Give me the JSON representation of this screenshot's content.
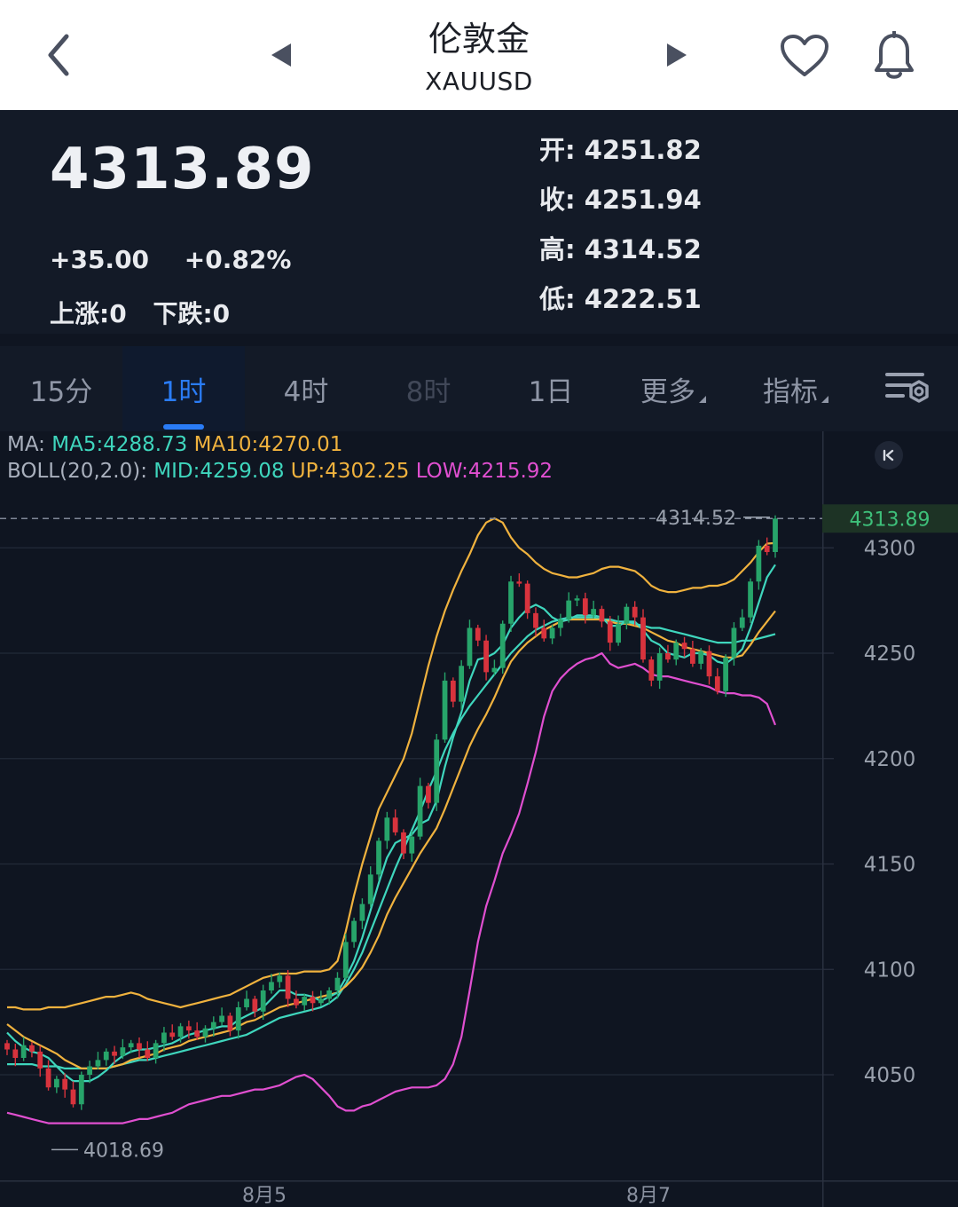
{
  "header": {
    "title": "伦敦金",
    "symbol": "XAUUSD"
  },
  "quote": {
    "price": "4313.89",
    "change": "+35.00",
    "change_pct": "+0.82%",
    "rise_label": "上涨:0",
    "fall_label": "下跌:0",
    "open": "开: 4251.82",
    "close": "收: 4251.94",
    "high": "高: 4314.52",
    "low": "低: 4222.51"
  },
  "tabs": {
    "m15": "15分",
    "h1": "1时",
    "h4": "4时",
    "h8": "8时",
    "d1": "1日",
    "more": "更多",
    "indicators": "指标"
  },
  "legend": {
    "ma_prefix": "MA: ",
    "ma5": "MA5:4288.73",
    "ma10": "MA10:4270.01",
    "boll_prefix": "BOLL(20,2.0): ",
    "boll_mid": "MID:4259.08",
    "boll_up": "UP:4302.25",
    "boll_low": "LOW:4215.92"
  },
  "colors": {
    "up": "#27a46a",
    "down": "#d8333d",
    "ma5": "#3fd6bd",
    "ma10": "#f0b23e",
    "boll_up": "#f0b23e",
    "boll_mid": "#3fd6bd",
    "boll_low": "#e04fd0",
    "accent": "#2a7cf6"
  },
  "chart_data": {
    "type": "candlestick",
    "timeframe": "1时",
    "ylim": [
      4010,
      4330
    ],
    "y_ticks": [
      "4300",
      "4250",
      "4200",
      "4150",
      "4100",
      "4050"
    ],
    "x_labels": [
      "8月5",
      "8月7"
    ],
    "current_price": "4313.89",
    "max_marker": "4314.52",
    "min_marker": "4018.69",
    "legend_items": [
      "MA5",
      "MA10",
      "MID",
      "UP",
      "LOW"
    ],
    "close": [
      4062,
      4058,
      4064,
      4061,
      4053,
      4044,
      4048,
      4043,
      4036,
      4050,
      4054,
      4057,
      4061,
      4059,
      4063,
      4065,
      4062,
      4058,
      4065,
      4070,
      4068,
      4073,
      4071,
      4068,
      4072,
      4075,
      4078,
      4071,
      4082,
      4086,
      4080,
      4090,
      4094,
      4097,
      4086,
      4083,
      4087,
      4084,
      4086,
      4090,
      4096,
      4113,
      4123,
      4131,
      4145,
      4161,
      4172,
      4165,
      4155,
      4163,
      4187,
      4179,
      4209,
      4237,
      4227,
      4244,
      4262,
      4256,
      4241,
      4243,
      4264,
      4284,
      4283,
      4269,
      4262,
      4257,
      4262,
      4266,
      4275,
      4276,
      4268,
      4271,
      4265,
      4255,
      4264,
      4272,
      4267,
      4247,
      4237,
      4250,
      4247,
      4255,
      4252,
      4245,
      4251,
      4239,
      4232,
      4248,
      4262,
      4267,
      4284,
      4301,
      4298,
      4313.89
    ],
    "ma5": [
      4070,
      4066,
      4063,
      4061,
      4060,
      4058,
      4054,
      4050,
      4047,
      4047,
      4047,
      4049,
      4052,
      4056,
      4059,
      4061,
      4062,
      4062,
      4063,
      4064,
      4065,
      4067,
      4069,
      4070,
      4071,
      4072,
      4073,
      4073,
      4076,
      4078,
      4080,
      4082,
      4086,
      4090,
      4090,
      4088,
      4088,
      4087,
      4085,
      4087,
      4089,
      4096,
      4104,
      4115,
      4128,
      4141,
      4153,
      4160,
      4162,
      4164,
      4169,
      4171,
      4180,
      4196,
      4210,
      4222,
      4237,
      4247,
      4248,
      4250,
      4254,
      4262,
      4267,
      4271,
      4273,
      4271,
      4267,
      4265,
      4266,
      4268,
      4268,
      4268,
      4267,
      4263,
      4263,
      4265,
      4265,
      4261,
      4256,
      4254,
      4250,
      4249,
      4248,
      4250,
      4250,
      4249,
      4246,
      4245,
      4248,
      4252,
      4262,
      4274,
      4286,
      4292
    ],
    "ma10": [
      4074,
      4071,
      4068,
      4066,
      4064,
      4062,
      4060,
      4057,
      4055,
      4053,
      4053,
      4053,
      4053,
      4054,
      4055,
      4057,
      4058,
      4059,
      4060,
      4062,
      4063,
      4064,
      4066,
      4067,
      4068,
      4069,
      4070,
      4071,
      4073,
      4075,
      4076,
      4078,
      4080,
      4082,
      4083,
      4084,
      4085,
      4086,
      4087,
      4088,
      4089,
      4092,
      4096,
      4101,
      4108,
      4116,
      4126,
      4134,
      4141,
      4148,
      4155,
      4161,
      4167,
      4176,
      4186,
      4196,
      4206,
      4214,
      4221,
      4229,
      4238,
      4246,
      4251,
      4255,
      4258,
      4261,
      4263,
      4265,
      4266,
      4266,
      4266,
      4266,
      4266,
      4265,
      4264,
      4264,
      4263,
      4262,
      4260,
      4258,
      4256,
      4255,
      4253,
      4252,
      4251,
      4250,
      4249,
      4248,
      4248,
      4249,
      4254,
      4260,
      4265,
      4270
    ],
    "boll_up": [
      4082,
      4082,
      4081,
      4081,
      4081,
      4082,
      4082,
      4082,
      4083,
      4084,
      4085,
      4086,
      4087,
      4087,
      4088,
      4089,
      4088,
      4086,
      4085,
      4084,
      4083,
      4082,
      4083,
      4084,
      4085,
      4086,
      4087,
      4088,
      4090,
      4092,
      4094,
      4096,
      4097,
      4098,
      4098,
      4098,
      4099,
      4099,
      4099,
      4100,
      4104,
      4118,
      4135,
      4150,
      4163,
      4176,
      4184,
      4192,
      4200,
      4212,
      4228,
      4244,
      4258,
      4270,
      4280,
      4289,
      4297,
      4306,
      4312,
      4314,
      4312,
      4305,
      4300,
      4297,
      4293,
      4290,
      4288,
      4287,
      4286,
      4286,
      4287,
      4288,
      4290,
      4291,
      4291,
      4290,
      4289,
      4286,
      4282,
      4280,
      4279,
      4279,
      4280,
      4281,
      4281,
      4282,
      4282,
      4283,
      4285,
      4289,
      4293,
      4298,
      4302,
      4302.25
    ],
    "boll_mid": [
      4055,
      4055,
      4055,
      4055,
      4054,
      4054,
      4054,
      4053,
      4053,
      4053,
      4053,
      4053,
      4053,
      4054,
      4055,
      4056,
      4057,
      4057,
      4058,
      4059,
      4060,
      4061,
      4062,
      4063,
      4064,
      4065,
      4066,
      4067,
      4068,
      4069,
      4071,
      4073,
      4075,
      4077,
      4078,
      4079,
      4080,
      4081,
      4082,
      4084,
      4087,
      4093,
      4100,
      4108,
      4118,
      4128,
      4138,
      4148,
      4157,
      4166,
      4175,
      4185,
      4194,
      4204,
      4212,
      4219,
      4225,
      4230,
      4235,
      4240,
      4245,
      4250,
      4254,
      4258,
      4261,
      4263,
      4265,
      4266,
      4267,
      4267,
      4267,
      4267,
      4266,
      4266,
      4265,
      4265,
      4264,
      4263,
      4262,
      4262,
      4261,
      4260,
      4259,
      4258,
      4257,
      4256,
      4255,
      4255,
      4255,
      4256,
      4256,
      4257,
      4258,
      4259.08
    ],
    "boll_low": [
      4032,
      4031,
      4030,
      4029,
      4028,
      4027,
      4027,
      4027,
      4027,
      4027,
      4027,
      4027,
      4027,
      4027,
      4027,
      4028,
      4029,
      4029,
      4030,
      4031,
      4032,
      4034,
      4036,
      4037,
      4038,
      4039,
      4040,
      4040,
      4041,
      4042,
      4043,
      4043,
      4044,
      4045,
      4047,
      4049,
      4050,
      4048,
      4044,
      4040,
      4035,
      4033,
      4033,
      4035,
      4036,
      4038,
      4040,
      4042,
      4043,
      4044,
      4044,
      4044,
      4045,
      4048,
      4055,
      4068,
      4090,
      4113,
      4130,
      4142,
      4155,
      4164,
      4174,
      4188,
      4203,
      4220,
      4232,
      4238,
      4242,
      4245,
      4247,
      4248,
      4250,
      4245,
      4243,
      4244,
      4245,
      4243,
      4240,
      4239,
      4239,
      4238,
      4237,
      4236,
      4235,
      4234,
      4232,
      4231,
      4231,
      4230,
      4230,
      4229,
      4226,
      4215.92
    ]
  }
}
